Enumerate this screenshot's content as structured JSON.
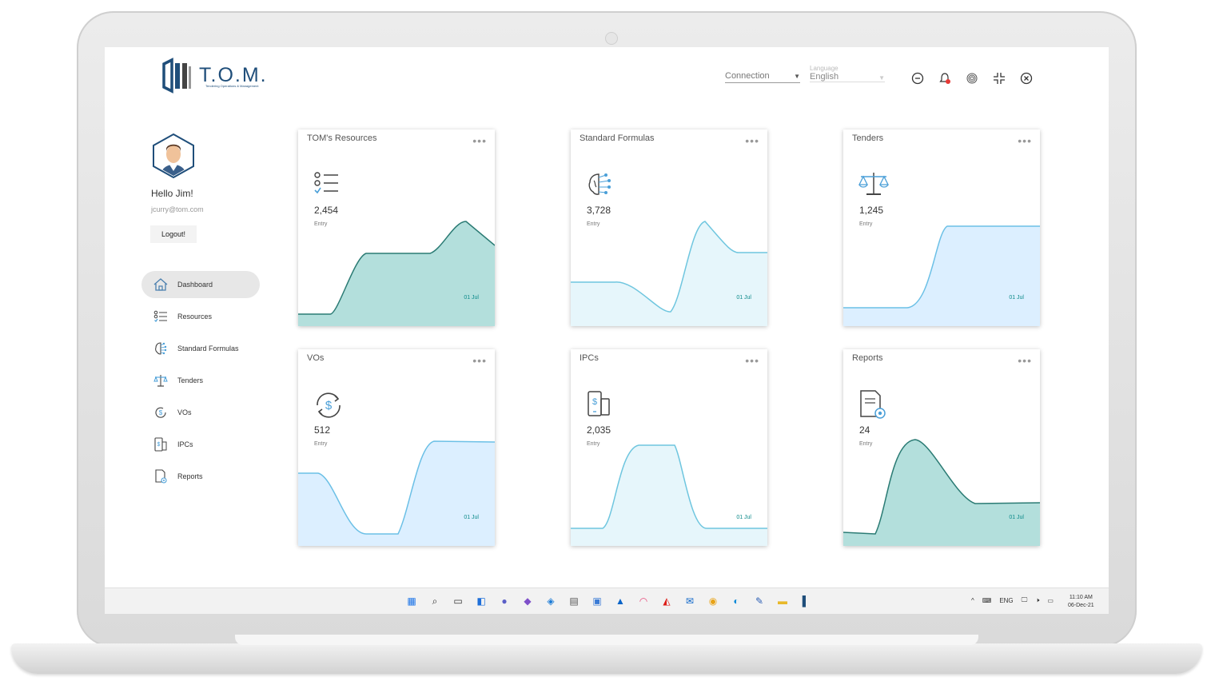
{
  "app": {
    "logo_text": "T.O.M.",
    "logo_subtext": "Tendering Operations & Management"
  },
  "header": {
    "connection_value": "Connection",
    "language_label": "Language",
    "language_value": "English"
  },
  "profile": {
    "greeting": "Hello Jim!",
    "email": "jcurry@tom.com",
    "logout_label": "Logout!"
  },
  "sidebar": {
    "items": [
      {
        "label": "Dashboard",
        "icon": "home-icon"
      },
      {
        "label": "Resources",
        "icon": "checklist-icon"
      },
      {
        "label": "Standard Formulas",
        "icon": "brain-icon"
      },
      {
        "label": "Tenders",
        "icon": "scales-icon"
      },
      {
        "label": "VOs",
        "icon": "dollar-cycle-icon"
      },
      {
        "label": "IPCs",
        "icon": "phone-dollar-icon"
      },
      {
        "label": "Reports",
        "icon": "report-icon"
      }
    ]
  },
  "cards": [
    {
      "title": "TOM's Resources",
      "value": "2,454",
      "label": "Entry",
      "date": "01 Jul",
      "icon": "checklist-icon",
      "style": "teal"
    },
    {
      "title": "Standard Formulas",
      "value": "3,728",
      "label": "Entry",
      "date": "01 Jul",
      "icon": "brain-icon",
      "style": "cyan"
    },
    {
      "title": "Tenders",
      "value": "1,245",
      "label": "Entry",
      "date": "01 Jul",
      "icon": "scales-icon",
      "style": "blue"
    },
    {
      "title": "VOs",
      "value": "512",
      "label": "Entry",
      "date": "01 Jul",
      "icon": "dollar-cycle-icon",
      "style": "blue"
    },
    {
      "title": "IPCs",
      "value": "2,035",
      "label": "Entry",
      "date": "01 Jul",
      "icon": "phone-dollar-icon",
      "style": "cyan"
    },
    {
      "title": "Reports",
      "value": "24",
      "label": "Entry",
      "date": "01 Jul",
      "icon": "report-icon",
      "style": "teal"
    }
  ],
  "taskbar": {
    "apps": [
      "windows-start-icon",
      "search-icon",
      "task-view-icon",
      "widgets-icon",
      "chat-icon",
      "visual-studio-icon",
      "azure-devops-icon",
      "notepad-icon",
      "printer-app-icon",
      "azure-icon",
      "clickup-icon",
      "angular-icon",
      "outlook-icon",
      "chrome-icon",
      "edge-icon",
      "tools-icon",
      "file-explorer-icon",
      "tom-app-icon"
    ],
    "lang": "ENG",
    "time": "11:10 AM",
    "date": "06-Dec-21"
  },
  "colors": {
    "brand": "#1f4e7a",
    "teal_fill": "#b3dfdc",
    "teal_line": "#2b7b74",
    "cyan_fill": "#e6f6fb",
    "cyan_line": "#6fc6df",
    "blue_fill": "#dcefff",
    "blue_line": "#6cc0e6"
  }
}
